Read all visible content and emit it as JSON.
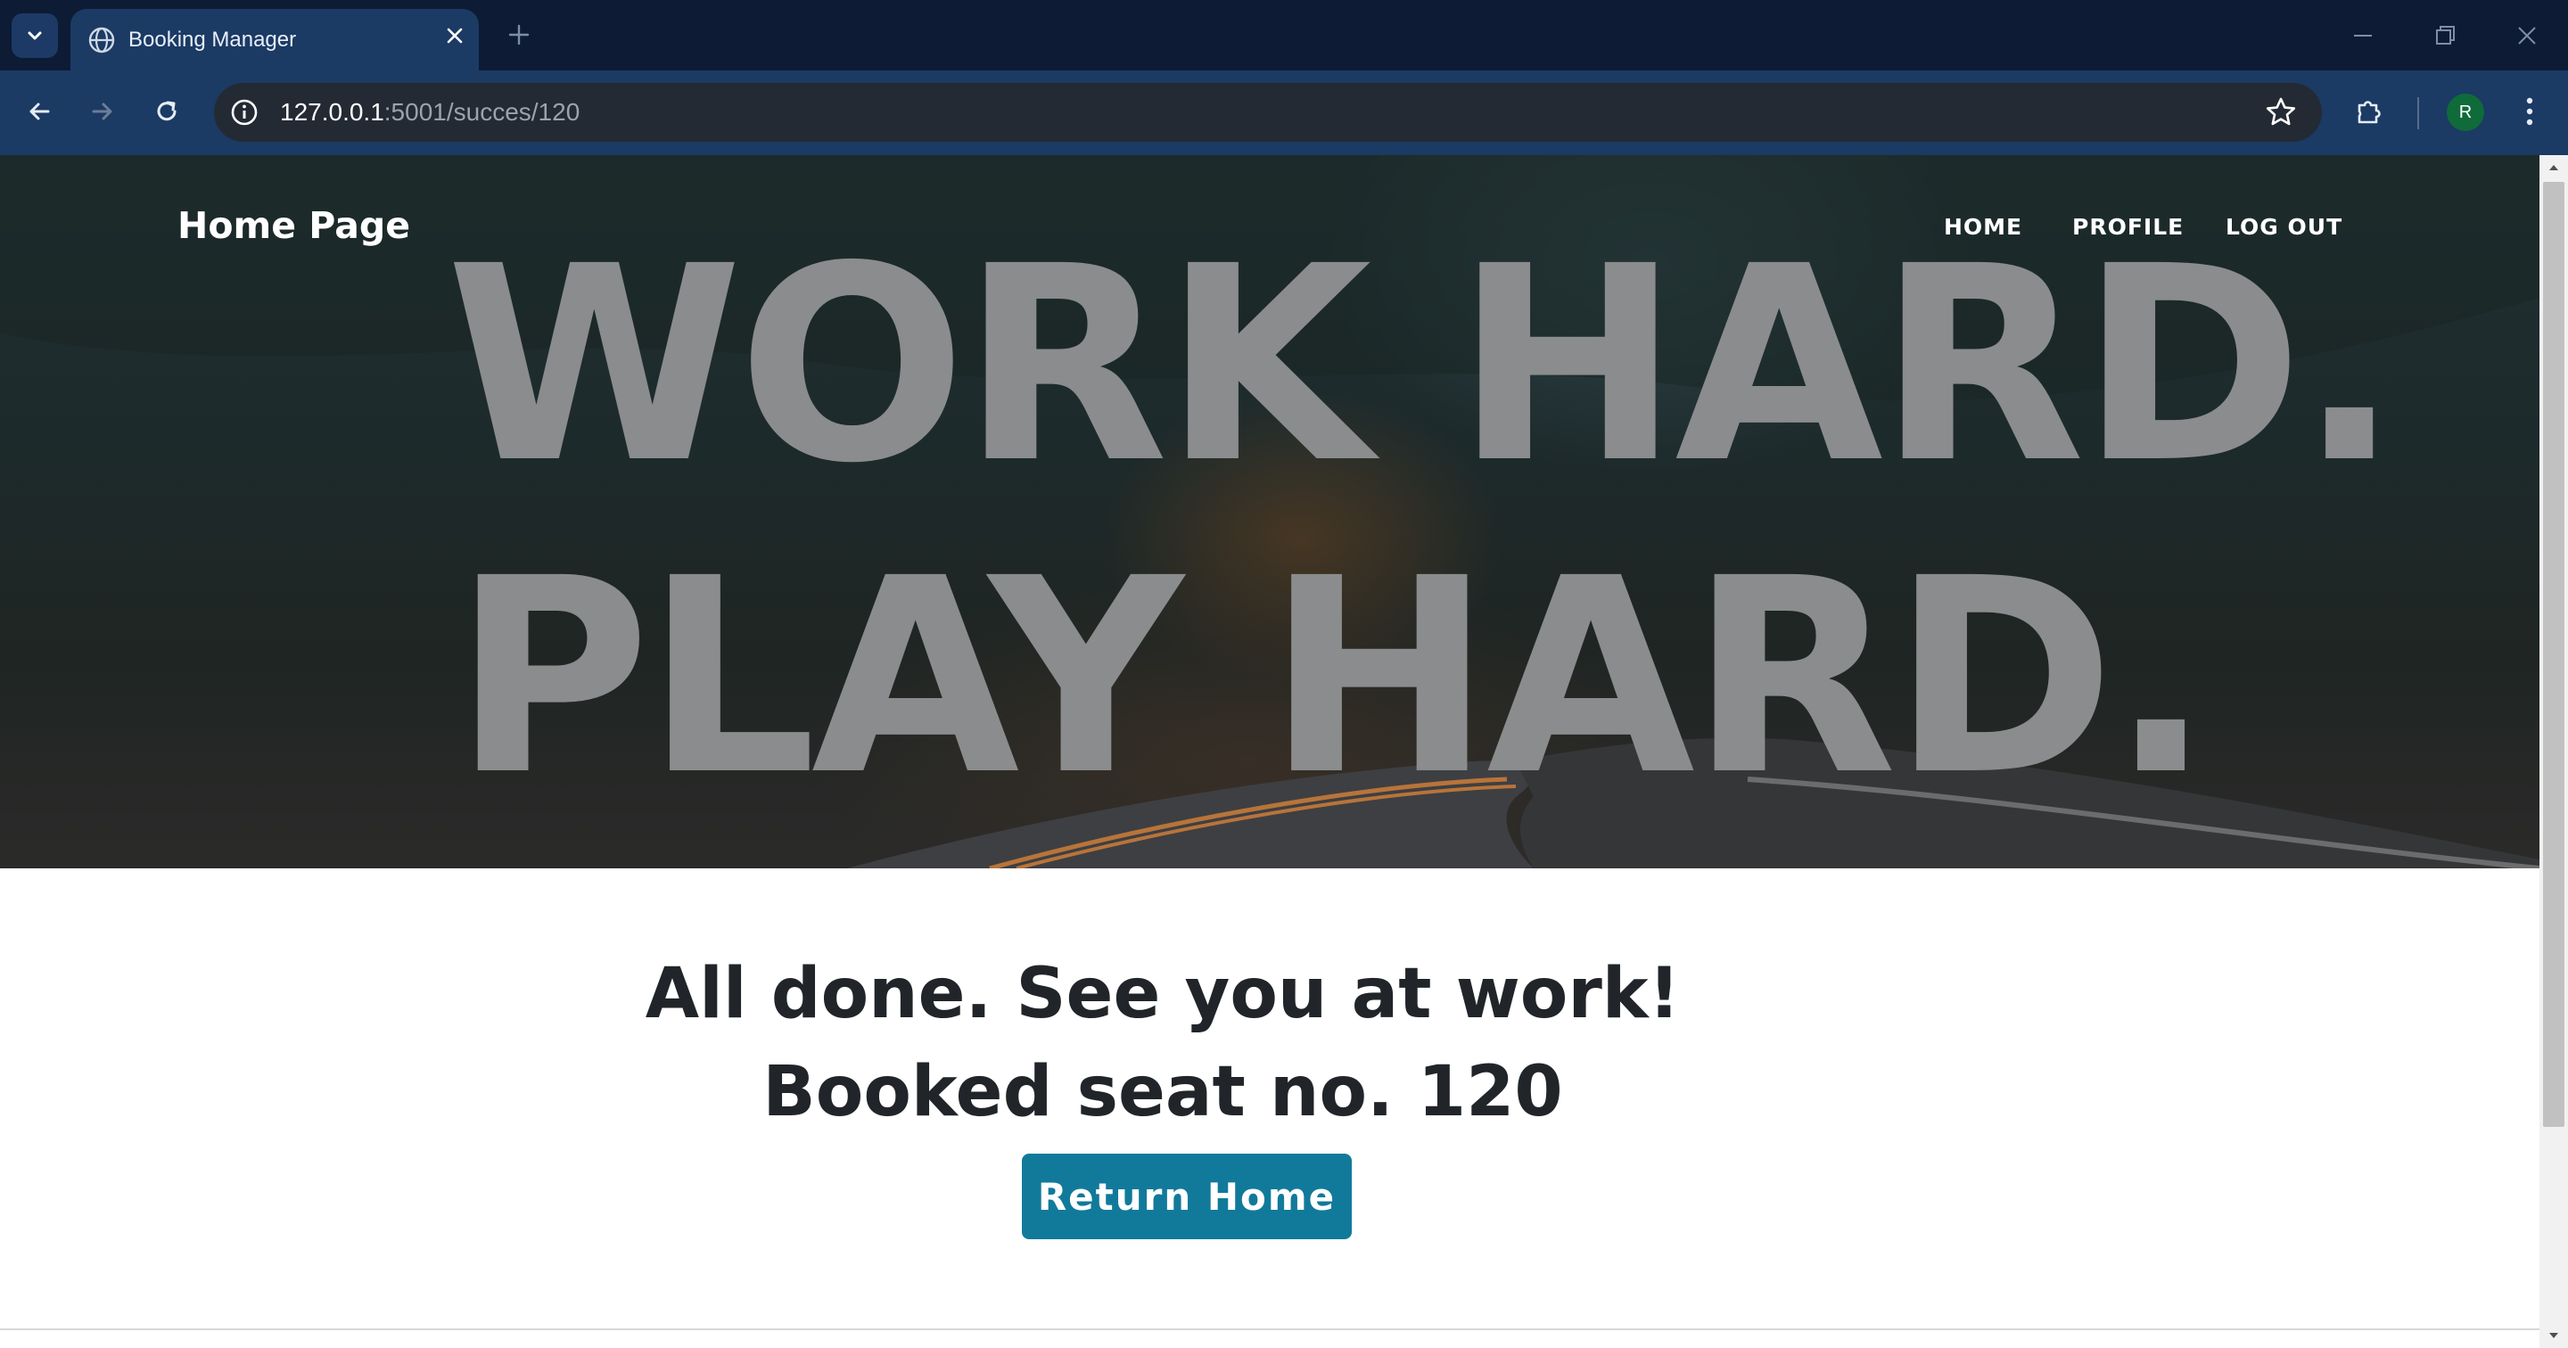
{
  "browser": {
    "tab_title": "Booking Manager",
    "url_host": "127.0.0.1",
    "url_path": ":5001/succes/120",
    "profile_initial": "R"
  },
  "site": {
    "brand": "Home Page",
    "nav": [
      "HOME",
      "PROFILE",
      "LOG OUT"
    ],
    "slogan_line1": "WORK HARD.",
    "slogan_line2": "PLAY HARD."
  },
  "result": {
    "line1": "All done. See you at work!",
    "line2": "Booked seat no. 120",
    "button_label": "Return Home"
  },
  "colors": {
    "tabstrip": "#0d1b35",
    "toolbar": "#1b3a64",
    "button": "#117a9a",
    "heading": "#212529"
  }
}
